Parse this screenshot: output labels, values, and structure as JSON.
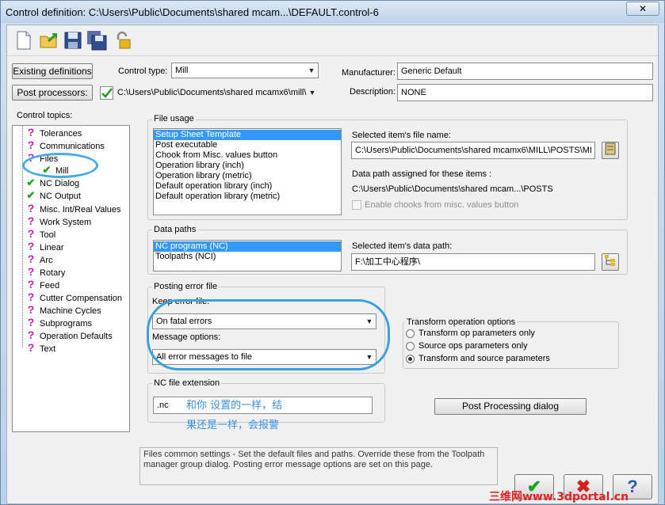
{
  "window": {
    "title": "Control definition: C:\\Users\\Public\\Documents\\shared mcam...\\DEFAULT.control-6",
    "close_symbol": "✕"
  },
  "toolbar": {
    "icons": [
      "new-file-icon",
      "open-folder-icon",
      "save-icon",
      "save-all-icon",
      "lock-icon"
    ]
  },
  "header": {
    "existing_definitions_label": "Existing definitions",
    "post_processors_label": "Post processors:",
    "control_type_label": "Control type:",
    "control_type_value": "Mill",
    "post_path_value": "C:\\Users\\Public\\Documents\\shared mcamx6\\mill\\",
    "manufacturer_label": "Manufacturer:",
    "manufacturer_value": "Generic Default",
    "description_label": "Description:",
    "description_value": "NONE"
  },
  "topics": {
    "label": "Control topics:",
    "items": [
      {
        "label": "Tolerances",
        "icon": "question-icon"
      },
      {
        "label": "Communications",
        "icon": "question-icon"
      },
      {
        "label": "Files",
        "icon": "question-icon"
      },
      {
        "label": "Mill",
        "icon": "check-icon"
      },
      {
        "label": "NC Dialog",
        "icon": "check-icon"
      },
      {
        "label": "NC Output",
        "icon": "check-icon"
      },
      {
        "label": "Misc. Int/Real Values",
        "icon": "question-icon"
      },
      {
        "label": "Work System",
        "icon": "question-icon"
      },
      {
        "label": "Tool",
        "icon": "question-icon"
      },
      {
        "label": "Linear",
        "icon": "question-icon"
      },
      {
        "label": "Arc",
        "icon": "question-icon"
      },
      {
        "label": "Rotary",
        "icon": "question-icon"
      },
      {
        "label": "Feed",
        "icon": "question-icon"
      },
      {
        "label": "Cutter Compensation",
        "icon": "question-icon"
      },
      {
        "label": "Machine Cycles",
        "icon": "question-icon"
      },
      {
        "label": "Subprograms",
        "icon": "question-icon"
      },
      {
        "label": "Operation Defaults",
        "icon": "question-icon"
      },
      {
        "label": "Text",
        "icon": "question-icon"
      }
    ]
  },
  "file_usage": {
    "title": "File usage",
    "items": [
      "Setup Sheet Template",
      "Post executable",
      "Chook from Misc. values button",
      "Operation library (inch)",
      "Operation library (metric)",
      "Default operation library (inch)",
      "Default operation library (metric)"
    ],
    "selected_index": 0,
    "file_name_label": "Selected item's file name:",
    "file_name_value": "C:\\Users\\Public\\Documents\\shared mcamx6\\MILL\\POSTS\\MI",
    "data_path_label": "Data path assigned for these items :",
    "data_path_value": "C:\\Users\\Public\\Documents\\shared mcam...\\POSTS",
    "enable_chooks_label": "Enable chooks from misc. values button"
  },
  "data_paths": {
    "title": "Data paths",
    "items": [
      "NC programs (NC)",
      "Toolpaths (NCI)"
    ],
    "selected_index": 0,
    "data_path_label": "Selected item's data path:",
    "data_path_value": "F:\\加工中心程序\\"
  },
  "posting_error": {
    "title": "Posting error file",
    "keep_label": "Keep error file:",
    "keep_value": "On fatal errors",
    "message_label": "Message options:",
    "message_value": "All error messages to file"
  },
  "transform": {
    "title": "Transform operation options",
    "options": [
      "Transform op parameters only",
      "Source ops parameters only",
      "Transform and source parameters"
    ],
    "selected_index": 2
  },
  "nc_ext": {
    "title": "NC file extension",
    "value": ".nc"
  },
  "post_processing_dialog_label": "Post Processing dialog",
  "help_text": "Files common settings - Set the default files and paths.  Override these from the Toolpath manager group dialog.  Posting error message options are set on this page.",
  "annotation": {
    "line1": "和你 设置的一样，结",
    "line2": "果还是一样，会报警"
  },
  "buttons": {
    "ok_symbol": "✔",
    "cancel_symbol": "✖",
    "help_symbol": "?"
  },
  "watermark": "三维网www.3dportal.cn",
  "colors": {
    "selection": "#3399ff",
    "check": "#1aa31a",
    "question": "#c81eb4",
    "annotation": "#3b8fe0",
    "watermark": "#e32222"
  }
}
